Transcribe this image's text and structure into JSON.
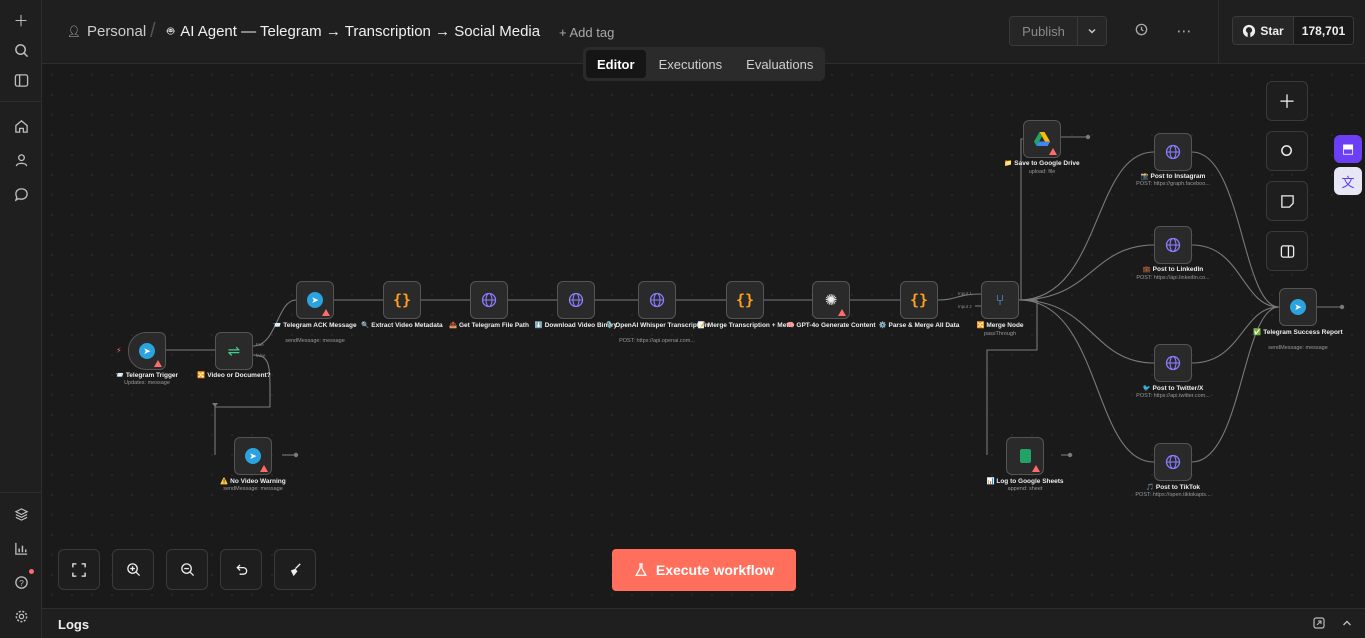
{
  "header": {
    "project": "Personal",
    "workflow_title": "AI Agent — Telegram → Transcription → Social Media",
    "add_tag": "+ Add tag",
    "publish": "Publish",
    "star": "Star",
    "star_count": "178,701"
  },
  "tabs": [
    {
      "label": "Editor"
    },
    {
      "label": "Executions"
    },
    {
      "label": "Evaluations"
    }
  ],
  "nodes": {
    "telegram_trigger": {
      "label": "📨 Telegram Trigger",
      "sub": "Updates: message"
    },
    "video_or_document": {
      "label": "🔀 Video or Document?",
      "true_port": "true",
      "false_port": "false"
    },
    "telegram_ack": {
      "label": "📨 Telegram ACK Message",
      "sub": "sendMessage: message"
    },
    "extract_metadata": {
      "label": "🔍 Extract Video Metadata"
    },
    "get_file_path": {
      "label": "📤 Get Telegram File Path"
    },
    "download_binary": {
      "label": "⬇️ Download Video Binary"
    },
    "whisper": {
      "label": "🎙️ OpenAI Whisper Transcription",
      "sub": "POST: https://api.openai.com..."
    },
    "merge_transcription": {
      "label": "📝 Merge Transcription + Meta"
    },
    "gpt4o": {
      "label": "🧠 GPT-4o Generate Content"
    },
    "parse_merge": {
      "label": "⚙️ Parse & Merge All Data"
    },
    "merge_node": {
      "label": "🔀 Merge Node",
      "sub": "passThrough",
      "input1": "Input 1",
      "input2": "Input 2"
    },
    "no_video_warning": {
      "label": "⚠️ No Video Warning",
      "sub": "sendMessage: message"
    },
    "save_drive": {
      "label": "📁 Save to Google Drive",
      "sub": "upload: file"
    },
    "log_sheets": {
      "label": "📊 Log to Google Sheets",
      "sub": "append: sheet"
    },
    "post_instagram": {
      "label": "📸 Post to Instagram",
      "sub": "POST: https://graph.faceboo..."
    },
    "post_linkedin": {
      "label": "💼 Post to LinkedIn",
      "sub": "POST: https://api.linkedin.co..."
    },
    "post_twitter": {
      "label": "🐦 Post to Twitter/X",
      "sub": "POST: https://api.twitter.com..."
    },
    "post_tiktok": {
      "label": "🎵 Post to TikTok",
      "sub": "POST: https://open.tiktokapis..."
    },
    "telegram_success": {
      "label": "✅ Telegram Success Report",
      "sub": "sendMessage: message"
    }
  },
  "execute_button": "Execute workflow",
  "logs_title": "Logs",
  "colors": {
    "execute": "#ff6f5b",
    "telegram": "#2aa3df",
    "accent": "#7c4dff"
  }
}
